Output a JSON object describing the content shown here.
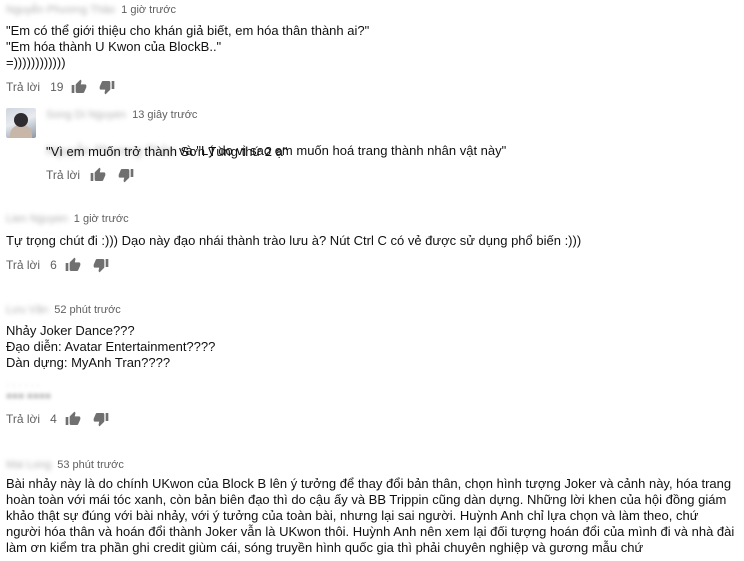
{
  "comments": [
    {
      "author": "Nguyễn Phương Thảo",
      "time": "1 giờ trước",
      "text": "\"Em có thể giới thiệu cho khán giả biết, em hóa thân thành ai?\"\n\"Em hóa thành U Kwon của BlockB..\"\n=))))))))))))",
      "reply_label": "Trả lời",
      "likes": "19"
    },
    {
      "author": "Song Di Nguyen",
      "time": "13 giây trước",
      "mention": "Nguyễn Phương Thảo",
      "text_line1": "và \"Lý do vì sao em muốn hoá trang thành nhân vật này\"",
      "text_line2": "\"Vì em muốn trở thành Sơn Tùng thứ 2 ạ\"",
      "reply_label": "Trả lời",
      "likes": ""
    },
    {
      "author": "Lien Nguyen",
      "time": "1 giờ trước",
      "text": "Tự trọng chút đi :))) Dạo này đạo nhái thành trào lưu à? Nút Ctrl C có vẻ được sử dụng phổ biến :)))",
      "reply_label": "Trả lời",
      "likes": "6"
    },
    {
      "author": "Lưu Văn",
      "time": "52 phút trước",
      "text": "Nhảy Joker Dance???\nĐạo diễn: Avatar Entertainment????\nDàn dựng: MyAnh Tran????",
      "reply_label": "Trả lời",
      "likes": "4"
    },
    {
      "author": "Mai Long",
      "time": "53 phút trước",
      "text": "Bài nhảy này là do chính UKwon của Block B lên ý tưởng để thay đổi bản thân, chọn hình tượng Joker và cảnh này, hóa trang hoàn toàn với mái tóc xanh, còn bản biên đạo thì do cậu ấy và BB Trippin cũng dàn dựng. Những lời khen của hội đồng giám khảo thật sự đúng với bài nhảy, với ý tưởng của toàn bài, nhưng lại sai người. Huỳnh Anh chỉ lựa chọn và làm theo, chứ người hóa thân và hoán đổi thành Joker vẫn là UKwon thôi. Huỳnh Anh nên xem lại đối tượng hoán đổi của mình đi và nhà đài làm ơn kiểm tra phần ghi credit giùm cái, sóng truyền hình quốc gia thì phải chuyên nghiệp và gương mẫu chứ"
    }
  ],
  "icons": {
    "like": "thumbs-up-icon",
    "dislike": "thumbs-down-icon"
  },
  "colors": {
    "text": "#111111",
    "meta": "#606060",
    "blurred_name": "#b3b3b3"
  }
}
